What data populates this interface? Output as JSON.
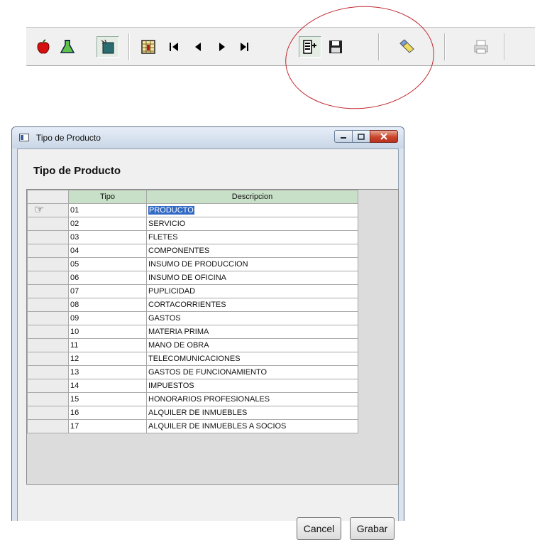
{
  "window": {
    "title": "Tipo de Producto",
    "heading": "Tipo de Producto",
    "controls": {
      "minimize": "minimize-icon",
      "maximize": "maximize-icon",
      "close": "close-icon"
    }
  },
  "grid": {
    "columns": [
      "Tipo",
      "Descripcion"
    ],
    "current_row_indicator": "pointing-hand-icon",
    "rows": [
      {
        "tipo": "01",
        "descripcion": "PRODUCTO"
      },
      {
        "tipo": "02",
        "descripcion": "SERVICIO"
      },
      {
        "tipo": "03",
        "descripcion": "FLETES"
      },
      {
        "tipo": "04",
        "descripcion": "COMPONENTES"
      },
      {
        "tipo": "05",
        "descripcion": "INSUMO DE PRODUCCION"
      },
      {
        "tipo": "06",
        "descripcion": "INSUMO DE OFICINA"
      },
      {
        "tipo": "07",
        "descripcion": "PUPLICIDAD"
      },
      {
        "tipo": "08",
        "descripcion": "CORTACORRIENTES"
      },
      {
        "tipo": "09",
        "descripcion": "GASTOS"
      },
      {
        "tipo": "10",
        "descripcion": "MATERIA PRIMA"
      },
      {
        "tipo": "11",
        "descripcion": "MANO DE OBRA"
      },
      {
        "tipo": "12",
        "descripcion": "TELECOMUNICACIONES"
      },
      {
        "tipo": "13",
        "descripcion": "GASTOS DE FUNCIONAMIENTO"
      },
      {
        "tipo": "14",
        "descripcion": "IMPUESTOS"
      },
      {
        "tipo": "15",
        "descripcion": "HONORARIOS PROFESIONALES"
      },
      {
        "tipo": "16",
        "descripcion": "ALQUILER DE INMUEBLES"
      },
      {
        "tipo": "17",
        "descripcion": "ALQUILER DE INMUEBLES A SOCIOS"
      }
    ]
  },
  "buttons": {
    "cancel": "Cancel",
    "save": "Grabar"
  },
  "toolbar": {
    "icons": [
      "apple-icon",
      "flask-icon",
      "sweeper-icon",
      "grid-filter-icon",
      "first-record-icon",
      "previous-record-icon",
      "next-record-icon",
      "last-record-icon",
      "form-view-icon",
      "save-icon",
      "eraser-icon",
      "printer-icon"
    ]
  },
  "colors": {
    "header_green": "#c8e0c8",
    "selection": "#316ac5",
    "annotation_circle": "#c0262c",
    "close_button": "#c9452b"
  }
}
